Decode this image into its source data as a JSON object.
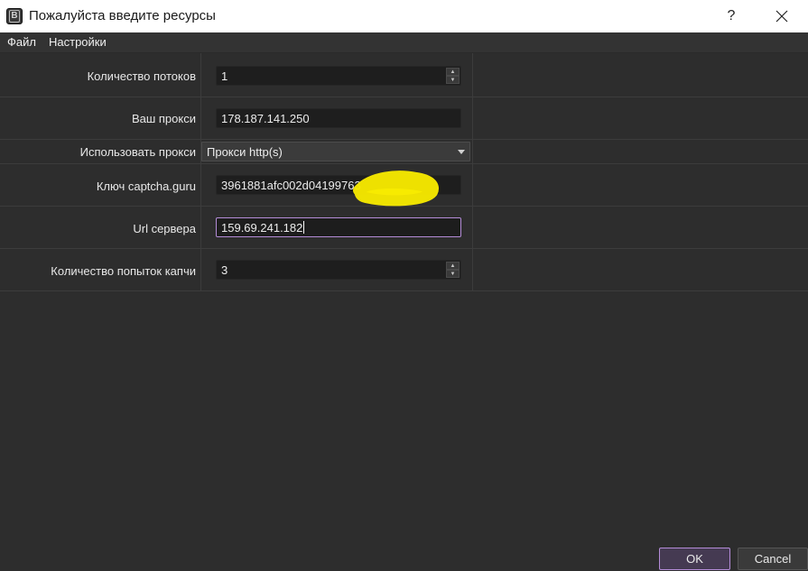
{
  "window": {
    "title": "Пожалуйста введите ресурсы",
    "app_icon_letter": "B",
    "help_label": "?"
  },
  "menu": [
    "Файл",
    "Настройки"
  ],
  "form": {
    "threads": {
      "label": "Количество потоков",
      "value": "1"
    },
    "proxy": {
      "label": "Ваш прокси",
      "value": "178.187.141.250"
    },
    "use_proxy": {
      "label": "Использовать прокси",
      "selected": "Прокси http(s)"
    },
    "captcha_key": {
      "label": "Ключ captcha.guru",
      "value": "3961881afc002d04199763"
    },
    "server_url": {
      "label": "Url сервера",
      "value": "159.69.241.182"
    },
    "captcha_attempts": {
      "label": "Количество попыток капчи",
      "value": "3"
    }
  },
  "buttons": {
    "ok": "OK",
    "cancel": "Cancel"
  },
  "colors": {
    "accent": "#b48cd8",
    "background": "#2d2d2d",
    "redaction": "#fff200"
  }
}
